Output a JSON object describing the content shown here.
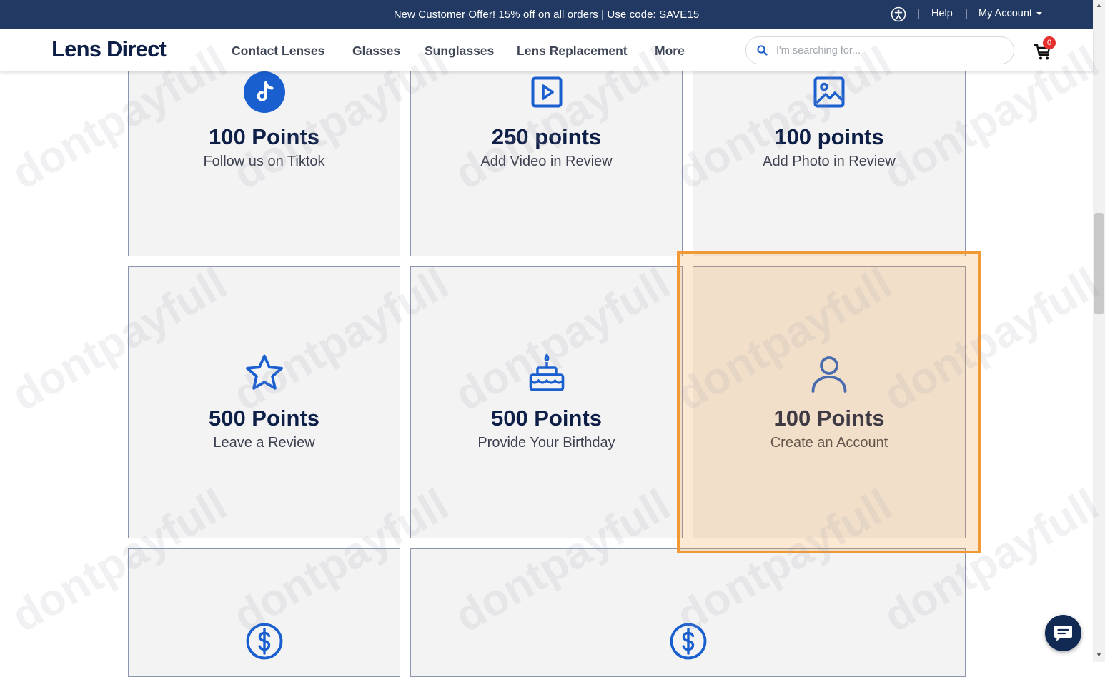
{
  "promo": {
    "text": "New Customer Offer! 15% off on all orders | Use code: SAVE15",
    "help_label": "Help",
    "account_label": "My Account",
    "separator": "|"
  },
  "header": {
    "logo": "Lens Direct",
    "nav": [
      "Contact Lenses",
      "Glasses",
      "Sunglasses",
      "Lens Replacement",
      "More"
    ],
    "search_placeholder": "I'm searching for...",
    "cart_count": "0"
  },
  "colors": {
    "accent_blue": "#1a5fd0",
    "navy": "#223a63",
    "highlight": "#f09a36",
    "badge": "#e5302d"
  },
  "cards": [
    {
      "points": "100 Points",
      "label": "Follow us on Tiktok",
      "icon": "tiktok-icon"
    },
    {
      "points": "250 points",
      "label": "Add Video in Review",
      "icon": "video-play-icon"
    },
    {
      "points": "100 points",
      "label": "Add Photo in Review",
      "icon": "image-icon"
    },
    {
      "points": "500 Points",
      "label": "Leave a Review",
      "icon": "star-icon"
    },
    {
      "points": "500 Points",
      "label": "Provide Your Birthday",
      "icon": "birthday-cake-icon"
    },
    {
      "points": "100 Points",
      "label": "Create an Account",
      "icon": "user-icon"
    },
    {
      "points": "",
      "label": "",
      "icon": "dollar-circle-icon"
    },
    {
      "points": "",
      "label": "",
      "icon": "dollar-circle-icon"
    }
  ],
  "watermark": "dontpayfull"
}
